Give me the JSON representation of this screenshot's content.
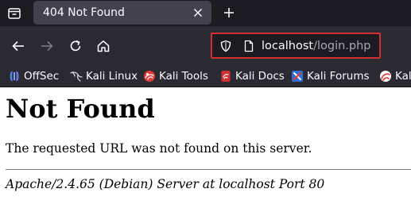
{
  "tabbar": {
    "tab_title": "404 Not Found"
  },
  "navbar": {
    "url_host": "localhost",
    "url_path": "/login.php"
  },
  "bookmarks": [
    {
      "label": "OffSec",
      "icon": "offsec-icon"
    },
    {
      "label": "Kali Linux",
      "icon": "kali-dragon-icon"
    },
    {
      "label": "Kali Tools",
      "icon": "kali-tools-icon"
    },
    {
      "label": "Kali Docs",
      "icon": "kali-docs-icon"
    },
    {
      "label": "Kali Forums",
      "icon": "kali-forums-icon"
    },
    {
      "label": "Kal",
      "icon": "kali-nethunter-icon"
    }
  ],
  "page": {
    "title": "Not Found",
    "message": "The requested URL was not found on this server.",
    "footer": "Apache/2.4.65 (Debian) Server at localhost Port 80"
  },
  "colors": {
    "tab_bar_bg": "#1c1b22",
    "toolbar_bg": "#2b2a33",
    "active_tab_bg": "#42414d",
    "url_focus_border": "#d32f2f",
    "page_bg": "#ffffff"
  }
}
